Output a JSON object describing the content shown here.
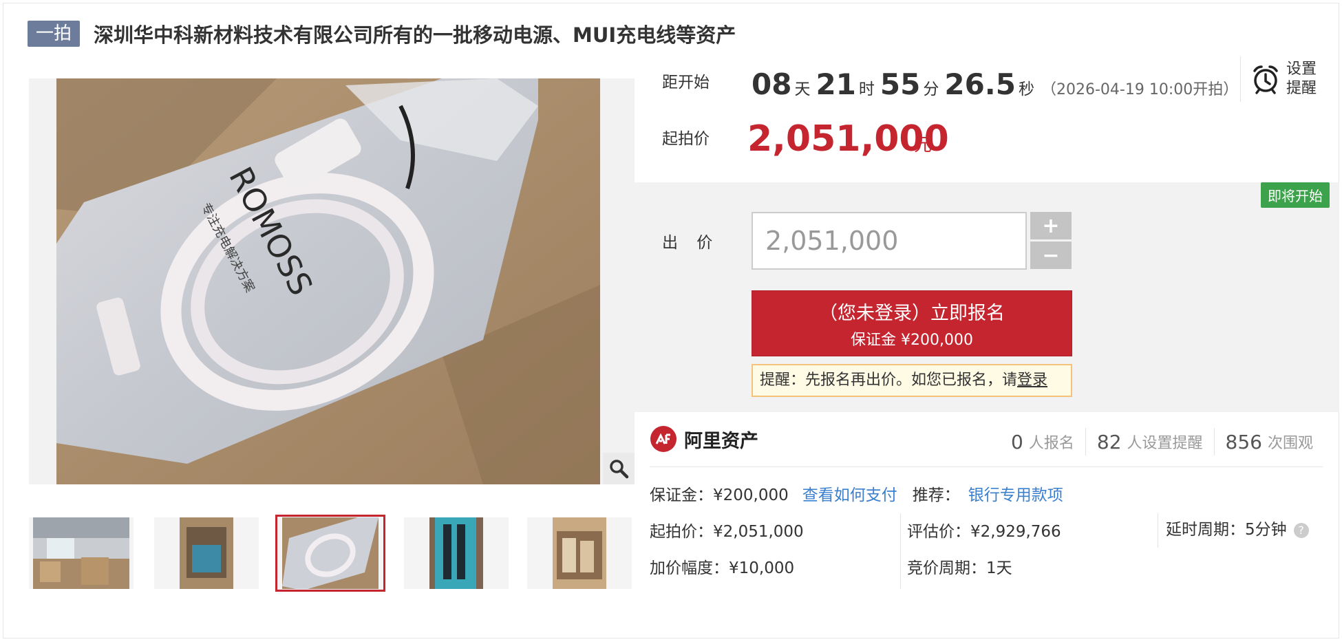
{
  "title": {
    "badge": "一拍",
    "text": "深圳华中科新材料技术有限公司所有的一批移动电源、MUI充电线等资产"
  },
  "countdown": {
    "label": "距开始",
    "days": "08",
    "days_unit": "天",
    "hours": "21",
    "hours_unit": "时",
    "minutes": "55",
    "minutes_unit": "分",
    "seconds": "26.5",
    "seconds_unit": "秒",
    "start_time": "（2026-04-19 10:00开拍）"
  },
  "reminder": {
    "line1": "设置",
    "line2": "提醒"
  },
  "start_price": {
    "label": "起拍价",
    "value": "2,051,000",
    "unit": "元"
  },
  "bid": {
    "status_tag": "即将开始",
    "label": "出 价",
    "input_value": "2,051,000",
    "plus": "+",
    "minus": "−",
    "signup_main": "（您未登录）立即报名",
    "signup_sub": "保证金 ¥200,000",
    "hint_text": "提醒：先报名再出价。如您已报名，请",
    "hint_link": "登录"
  },
  "brand": {
    "name": "阿里资产"
  },
  "stats": [
    {
      "num": "0",
      "label": "人报名"
    },
    {
      "num": "82",
      "label": "人设置提醒"
    },
    {
      "num": "856",
      "label": "次围观"
    }
  ],
  "details": {
    "deposit": "保证金：¥200,000",
    "pay_link": "查看如何支付",
    "recommend": "推荐：",
    "bank_link": "银行专用款项",
    "start_price": "起拍价：¥2,051,000",
    "appraisal": "评估价：¥2,929,766",
    "delay": "延时周期：5分钟",
    "increment": "加价幅度：¥10,000",
    "bid_period": "竞价周期：1天",
    "help": "?"
  },
  "product_print": {
    "brand": "ROMOSS",
    "tagline": "专注充电解决方案"
  },
  "colors": {
    "accent_red": "#c4252e",
    "badge_bg": "#6c7c9a",
    "link_blue": "#3b7fcf",
    "tag_green": "#3ca24b"
  }
}
